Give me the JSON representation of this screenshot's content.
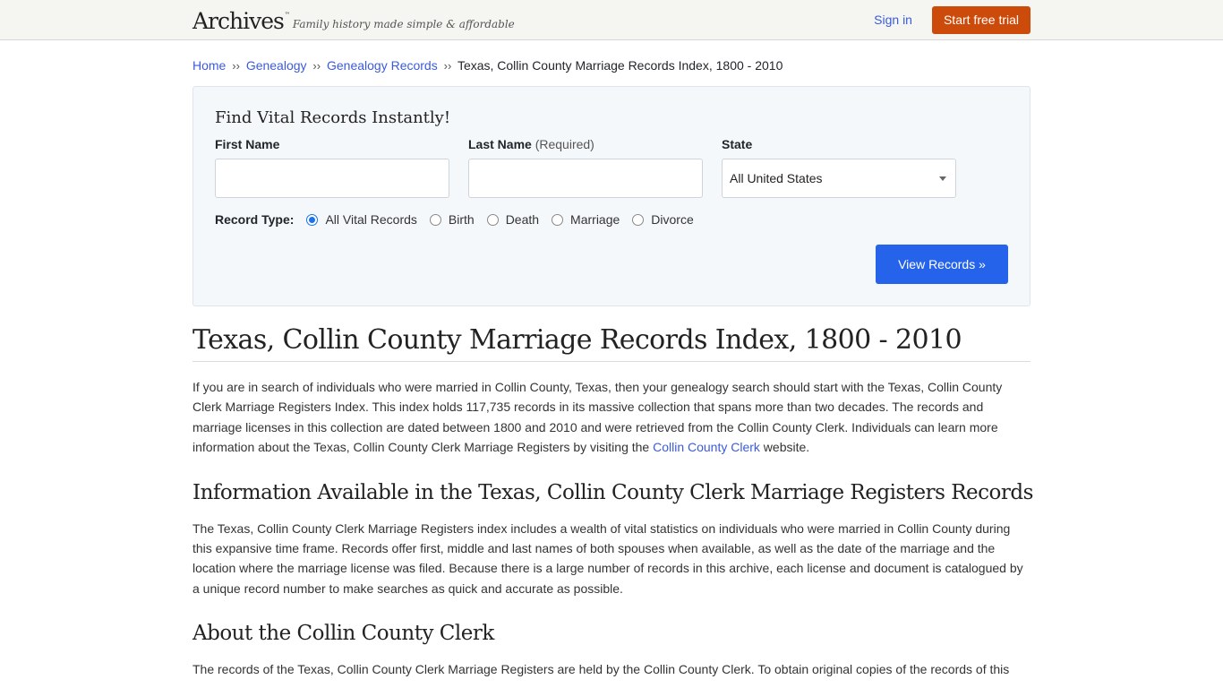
{
  "header": {
    "logo": "Archives",
    "logo_tm": "™",
    "tagline": "Family history made simple & affordable",
    "sign_in": "Sign in",
    "trial_button": "Start free trial"
  },
  "breadcrumb": {
    "items": [
      "Home",
      "Genealogy",
      "Genealogy Records"
    ],
    "separator": "››",
    "current": "Texas, Collin County Marriage Records Index, 1800 - 2010"
  },
  "search": {
    "title": "Find Vital Records Instantly!",
    "first_name_label": "First Name",
    "first_name_value": "",
    "last_name_label": "Last Name",
    "last_name_hint": "(Required)",
    "last_name_value": "",
    "state_label": "State",
    "state_value": "All United States",
    "record_type_label": "Record Type:",
    "record_types": [
      "All Vital Records",
      "Birth",
      "Death",
      "Marriage",
      "Divorce"
    ],
    "selected_record_type": "All Vital Records",
    "submit": "View Records »"
  },
  "article": {
    "title": "Texas, Collin County Marriage Records Index, 1800 - 2010",
    "intro_before_link": "If you are in search of individuals who were married in Collin County, Texas, then your genealogy search should start with the Texas, Collin County Clerk Marriage Registers Index. This index holds 117,735 records in its massive collection that spans more than two decades. The records and marriage licenses in this collection are dated between 1800 and 2010 and were retrieved from the Collin County Clerk. Individuals can learn more information about the Texas, Collin County Clerk Marriage Registers by visiting the ",
    "intro_link": "Collin County Clerk",
    "intro_after_link": " website.",
    "section1_title": "Information Available in the Texas, Collin County Clerk Marriage Registers Records",
    "section1_body": "The Texas, Collin County Clerk Marriage Registers index includes a wealth of vital statistics on individuals who were married in Collin County during this expansive time frame. Records offer first, middle and last names of both spouses when available, as well as the date of the marriage and the location where the marriage license was filed. Because there is a large number of records in this archive, each license and document is catalogued by a unique record number to make searches as quick and accurate as possible.",
    "section2_title": "About the Collin County Clerk",
    "section2_body": "The records of the Texas, Collin County Clerk Marriage Registers are held by the Collin County Clerk. To obtain original copies of the records of this"
  },
  "colors": {
    "link": "#3b5bdb",
    "trial_button": "#cc4a0a",
    "primary_button": "#2563eb",
    "search_panel_bg": "#f5f8fb"
  }
}
